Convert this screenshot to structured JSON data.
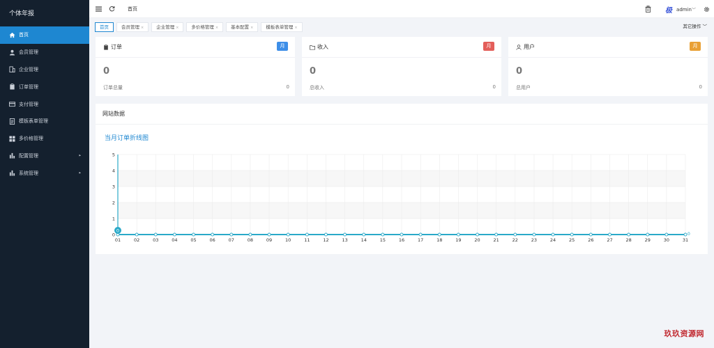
{
  "sidebar": {
    "title": "个体年报",
    "items": [
      {
        "label": "首页",
        "icon": "home-icon",
        "active": true
      },
      {
        "label": "会员管理",
        "icon": "user-icon"
      },
      {
        "label": "企业管理",
        "icon": "building-icon"
      },
      {
        "label": "订单管理",
        "icon": "clipboard-icon"
      },
      {
        "label": "支付管理",
        "icon": "card-icon"
      },
      {
        "label": "模板表单管理",
        "icon": "document-icon"
      },
      {
        "label": "多价格管理",
        "icon": "grid-icon"
      },
      {
        "label": "配置管理",
        "icon": "bar-chart-icon",
        "arrow": "▸"
      },
      {
        "label": "系统管理",
        "icon": "bar-chart-icon",
        "arrow": "▸"
      }
    ]
  },
  "header": {
    "breadcrumb": "首页",
    "avatar_text": "极",
    "username": "admin",
    "username_caret": "﹀"
  },
  "tabs": {
    "items": [
      {
        "label": "首页",
        "active": true
      },
      {
        "label": "会员管理",
        "close": "×"
      },
      {
        "label": "企业管理",
        "close": "×"
      },
      {
        "label": "多价格管理",
        "close": "×"
      },
      {
        "label": "基本配置",
        "close": "×"
      },
      {
        "label": "模板表单管理",
        "close": "×"
      }
    ],
    "ops_label": "其它操作 ﹀"
  },
  "cards": [
    {
      "title": "订单",
      "icon": "clipboard-icon",
      "badge": "月",
      "badge_color": "#3d8ee8",
      "value": "0",
      "label": "订单总量",
      "number": "0"
    },
    {
      "title": "收入",
      "icon": "folder-icon",
      "badge": "月",
      "badge_color": "#e35e5a",
      "value": "0",
      "label": "总收入",
      "number": "0"
    },
    {
      "title": "用户",
      "icon": "user-outline-icon",
      "badge": "月",
      "badge_color": "#e9a035",
      "value": "0",
      "label": "总用户",
      "number": "0"
    }
  ],
  "panel": {
    "title": "网站数据",
    "chart_title": "当月订单折线图"
  },
  "chart_data": {
    "type": "line",
    "title": "当月订单折线图",
    "categories": [
      "01",
      "02",
      "03",
      "04",
      "05",
      "06",
      "07",
      "08",
      "09",
      "10",
      "11",
      "12",
      "13",
      "14",
      "15",
      "16",
      "17",
      "18",
      "19",
      "20",
      "21",
      "22",
      "23",
      "24",
      "25",
      "26",
      "27",
      "28",
      "29",
      "30",
      "31"
    ],
    "series": [
      {
        "values": [
          0,
          0,
          0,
          0,
          0,
          0,
          0,
          0,
          0,
          0,
          0,
          0,
          0,
          0,
          0,
          0,
          0,
          0,
          0,
          0,
          0,
          0,
          0,
          0,
          0,
          0,
          0,
          0,
          0,
          0,
          0
        ]
      }
    ],
    "yticks": [
      0,
      1,
      2,
      3,
      4,
      5
    ],
    "ylim": [
      0,
      5
    ],
    "point_labels": {
      "first": "0",
      "last": "0"
    },
    "grid": true,
    "line_color": "#2aa9c8"
  },
  "watermark": "玖玖资源网"
}
